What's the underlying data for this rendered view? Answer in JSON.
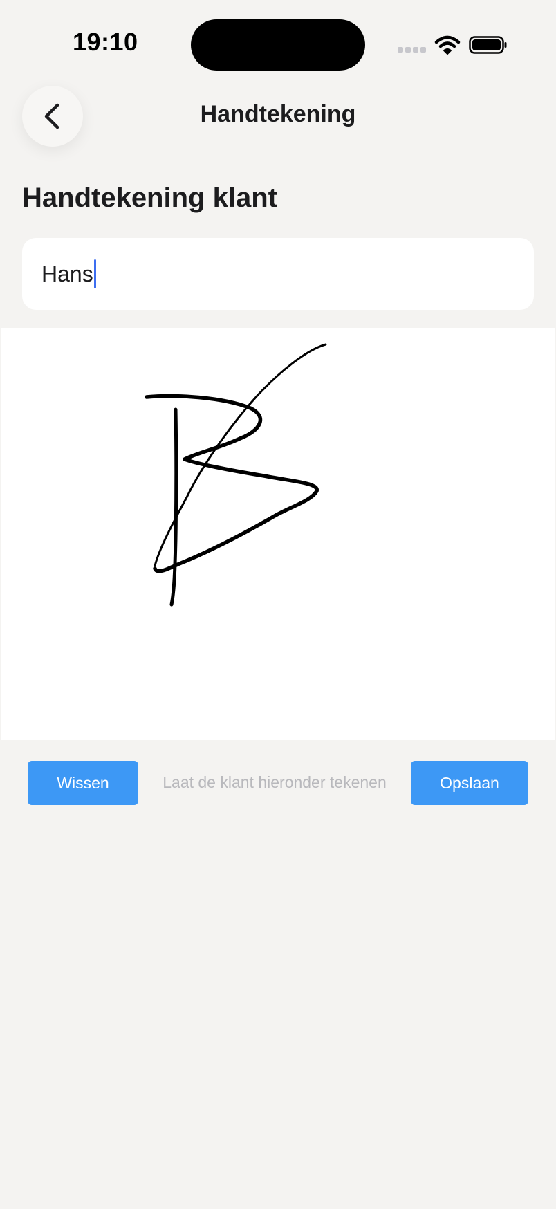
{
  "status_bar": {
    "time": "19:10"
  },
  "navigation": {
    "title": "Handtekening",
    "back_icon": "chevron-left-icon"
  },
  "section": {
    "title": "Handtekening klant"
  },
  "name_field": {
    "value": "Hans"
  },
  "signature": {
    "signed": true
  },
  "actions": {
    "clear_label": "Wissen",
    "hint": "Laat de klant hieronder tekenen",
    "save_label": "Opslaan"
  },
  "colors": {
    "accent": "#3d98f5",
    "background": "#f4f3f1",
    "caret": "#3d6ef0"
  }
}
